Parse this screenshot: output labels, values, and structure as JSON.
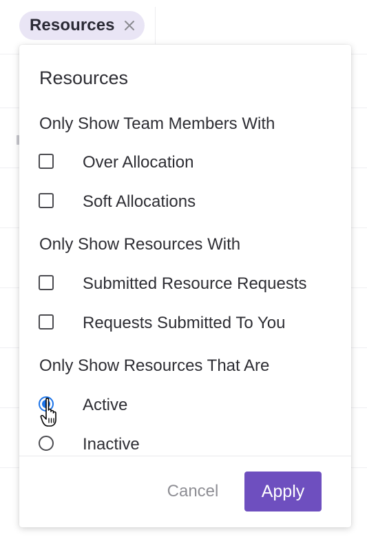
{
  "chip": {
    "label": "Resources"
  },
  "panel": {
    "title": "Resources",
    "sections": [
      {
        "label": "Only Show Team Members With",
        "type": "checkbox",
        "options": [
          {
            "label": "Over Allocation",
            "checked": false
          },
          {
            "label": "Soft Allocations",
            "checked": false
          }
        ]
      },
      {
        "label": "Only Show Resources With",
        "type": "checkbox",
        "options": [
          {
            "label": "Submitted Resource Requests",
            "checked": false
          },
          {
            "label": "Requests Submitted To You",
            "checked": false
          }
        ]
      },
      {
        "label": "Only Show Resources That Are",
        "type": "radio",
        "options": [
          {
            "label": "Active",
            "checked": true
          },
          {
            "label": "Inactive",
            "checked": false
          }
        ]
      }
    ],
    "footer": {
      "cancel_label": "Cancel",
      "apply_label": "Apply"
    }
  },
  "colors": {
    "accent": "#6e4fbf",
    "chip_bg": "#e9e5f5",
    "radio_checked": "#1a73e8"
  }
}
